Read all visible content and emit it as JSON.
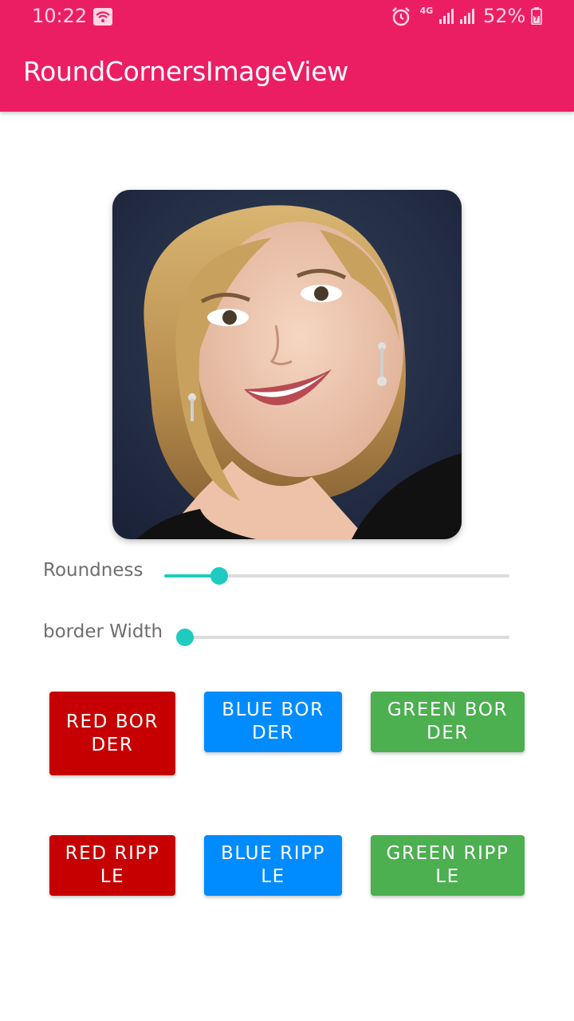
{
  "status_bar": {
    "time": "10:22",
    "network": "4G",
    "battery": "52%",
    "icons": [
      "wifi-icon",
      "alarm-icon",
      "signal-icon",
      "signal-icon",
      "battery-icon"
    ]
  },
  "app_bar": {
    "title": "RoundCornersImageView",
    "color": "#ec1e63"
  },
  "image": {
    "description_icon": "portrait-photo"
  },
  "sliders": [
    {
      "label": "Roundness",
      "value_fraction": 0.16,
      "accent": "#1ecbbe"
    },
    {
      "label": "border Width",
      "value_fraction": 0.0,
      "accent": "#1ecbbe"
    }
  ],
  "buttons": {
    "red_border": "RED BORDER",
    "blue_border": "BLUE BORDER",
    "green_border": "GREEN BORDER",
    "red_ripple": "RED RIPPLE",
    "blue_ripple": "BLUE RIPPLE",
    "green_ripple": "GREEN RIPPLE"
  },
  "colors": {
    "red": "#c60000",
    "blue": "#008cff",
    "green": "#4caf50"
  }
}
